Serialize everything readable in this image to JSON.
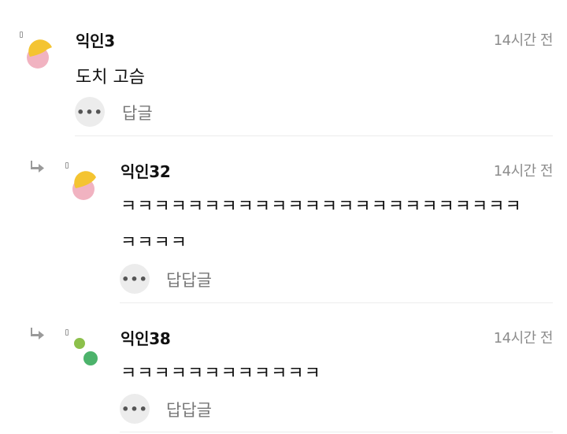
{
  "comments": [
    {
      "author": "익인3",
      "time": "14시간 전",
      "body": "도치 고슴",
      "more_icon": "ellipsis-icon",
      "reply_label": "답글",
      "avatar_colors": [
        "#f4c431",
        "#f1b3c1"
      ]
    },
    {
      "author": "익인32",
      "time": "14시간 전",
      "body_lines": [
        "ㅋㅋㅋㅋㅋㅋㅋㅋㅋㅋㅋㅋㅋㅋㅋㅋㅋㅋㅋㅋㅋㅋㅋㅋ",
        "ㅋㅋㅋㅋ"
      ],
      "more_icon": "ellipsis-icon",
      "reply_label": "답답글",
      "avatar_colors": [
        "#f4c431",
        "#f1b3c1"
      ]
    },
    {
      "author": "익인38",
      "time": "14시간 전",
      "body": "ㅋㅋㅋㅋㅋㅋㅋㅋㅋㅋㅋㅋ",
      "more_icon": "ellipsis-icon",
      "reply_label": "답답글",
      "avatar_colors": [
        "#8cc04b",
        "#4cb36b"
      ]
    }
  ],
  "icons": {
    "reply_arrow": "reply-arrow-icon",
    "more": "ellipsis-icon"
  },
  "colors": {
    "muted_text": "#8c8c8c",
    "button_bg": "#ececec",
    "divider": "#ececec"
  }
}
